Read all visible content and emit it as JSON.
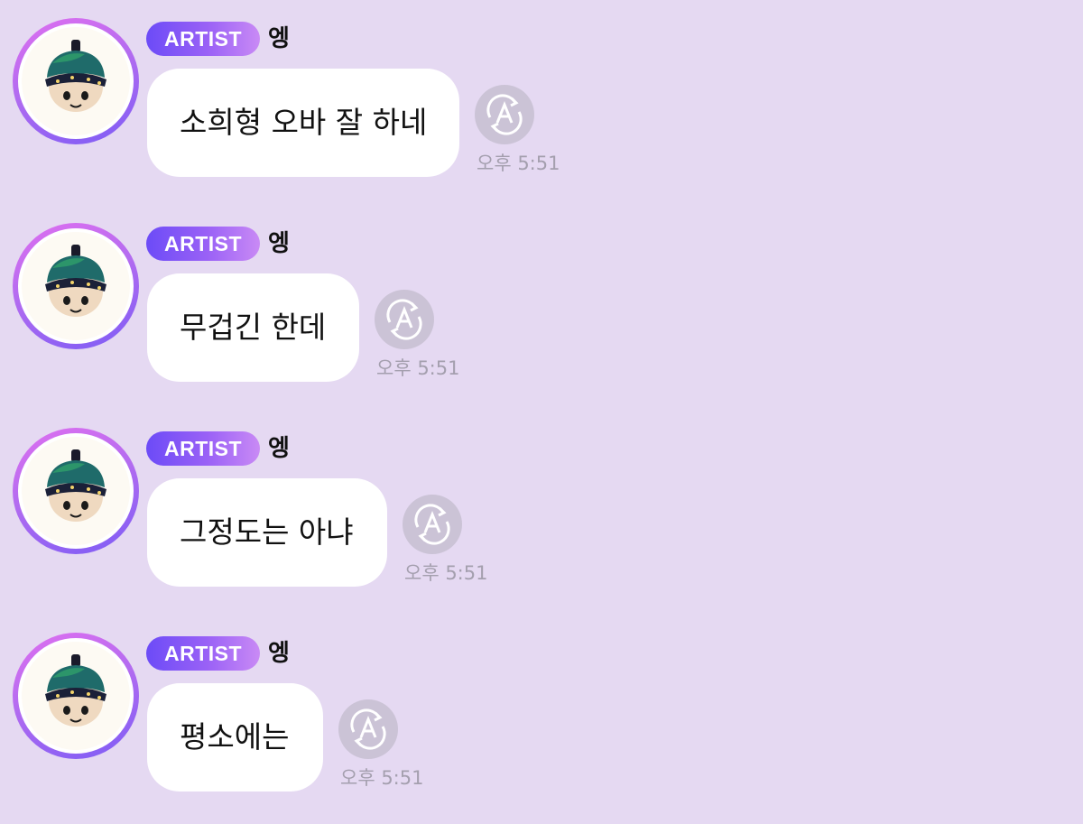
{
  "colors": {
    "background": "#e5d9f2",
    "bubble": "#ffffff",
    "badge_gradient_start": "#6c4bf7",
    "badge_gradient_end": "#c98af5",
    "translate_button": "#cbc3d6",
    "timestamp": "#a49fae"
  },
  "messages": [
    {
      "badge": "ARTIST",
      "sender": "엥",
      "text": "소희형 오바 잘 하네",
      "time": "오후 5:51",
      "avatar_icon": "plush-doll-avatar",
      "action_icon": "translate-icon"
    },
    {
      "badge": "ARTIST",
      "sender": "엥",
      "text": "무겁긴 한데",
      "time": "오후 5:51",
      "avatar_icon": "plush-doll-avatar",
      "action_icon": "translate-icon"
    },
    {
      "badge": "ARTIST",
      "sender": "엥",
      "text": "그정도는 아냐",
      "time": "오후 5:51",
      "avatar_icon": "plush-doll-avatar",
      "action_icon": "translate-icon"
    },
    {
      "badge": "ARTIST",
      "sender": "엥",
      "text": "평소에는",
      "time": "오후 5:51",
      "avatar_icon": "plush-doll-avatar",
      "action_icon": "translate-icon"
    }
  ]
}
